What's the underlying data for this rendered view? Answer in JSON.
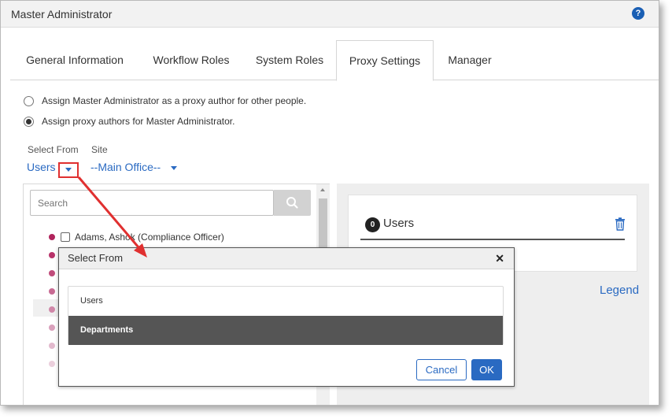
{
  "window": {
    "title": "Master Administrator",
    "help_glyph": "?"
  },
  "tabs": [
    {
      "label": "General Information"
    },
    {
      "label": "Workflow Roles"
    },
    {
      "label": "System Roles"
    },
    {
      "label": "Proxy Settings",
      "active": true
    },
    {
      "label": "Manager"
    }
  ],
  "proxy": {
    "option1": "Assign Master Administrator as a proxy author for other people.",
    "option2": "Assign proxy authors for Master Administrator.",
    "selected_option": 2
  },
  "select_from": {
    "label": "Select From",
    "value": "Users"
  },
  "site": {
    "label": "Site",
    "value": "--Main Office--"
  },
  "search": {
    "placeholder": "Search"
  },
  "people": [
    {
      "name": "Adams, Ashok (Compliance Officer)"
    }
  ],
  "users_card": {
    "count": "0",
    "title": "Users"
  },
  "legend": {
    "label": "Legend"
  },
  "dialog": {
    "title": "Select From",
    "close_glyph": "✕",
    "options": [
      {
        "label": "Users",
        "selected": false
      },
      {
        "label": "Departments",
        "selected": true
      }
    ],
    "cancel_label": "Cancel",
    "ok_label": "OK"
  },
  "colors": {
    "accent": "#2a6ac2",
    "callout": "#e03030",
    "dot_primary": "#b0245c",
    "selected_option_bg": "#555555"
  }
}
